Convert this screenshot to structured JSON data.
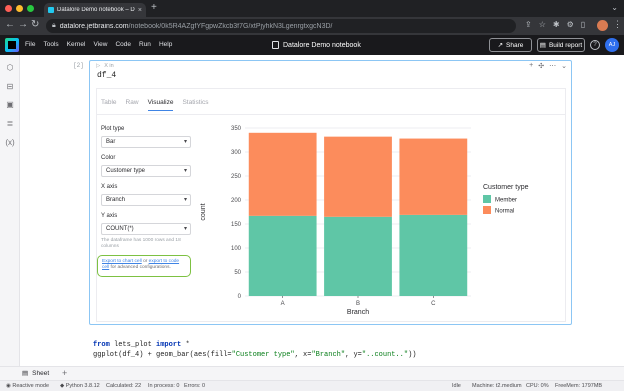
{
  "browser": {
    "tab_title": "Datalore Demo notebook – Dat",
    "url_domain": "datalore.jetbrains.com",
    "url_path": "/notebook/0k5R4AZgfYFgpwZkcb3f7G/xtPjyhkN3LgenrgtxgcN3D/"
  },
  "app": {
    "menu": [
      "File",
      "Tools",
      "Kernel",
      "View",
      "Code",
      "Run",
      "Help"
    ],
    "doc_title": "Datalore Demo notebook",
    "share_label": "Share",
    "build_label": "Build report",
    "help_label": "?",
    "avatar_initials": "AJ"
  },
  "cell1": {
    "number": "[2]",
    "toolbar": "X in",
    "code": "df_4",
    "tabs": [
      "Table",
      "Raw",
      "Visualize",
      "Statistics"
    ],
    "active_tab": "Visualize",
    "controls": {
      "plot_type_label": "Plot type",
      "plot_type_value": "Bar",
      "color_label": "Color",
      "color_value": "Customer type",
      "xaxis_label": "X axis",
      "xaxis_value": "Branch",
      "yaxis_label": "Y axis",
      "yaxis_value": "COUNT(*)"
    },
    "note": "The dataframe has 1000 rows and 18 columns",
    "export_link1": "Export to chart cell",
    "export_or": " or ",
    "export_link2": "export to code cell",
    "export_tail": " for advanced configurations."
  },
  "chart_data": {
    "type": "bar",
    "stacked": true,
    "categories": [
      "A",
      "B",
      "C"
    ],
    "series": [
      {
        "name": "Member",
        "values": [
          167,
          165,
          169
        ],
        "color": "#5fc6a6"
      },
      {
        "name": "Normal",
        "values": [
          173,
          167,
          159
        ],
        "color": "#fc8c5c"
      }
    ],
    "xlabel": "Branch",
    "ylabel": "count",
    "ylim": [
      0,
      350
    ],
    "yticks": [
      0,
      50,
      100,
      150,
      200,
      250,
      300,
      350
    ],
    "legend_title": "Customer type",
    "legend_position": "right",
    "grid": "horizontal"
  },
  "cell2": {
    "line1_kw1": "from",
    "line1_mid": " lets_plot ",
    "line1_kw2": "import",
    "line1_tail": " *",
    "line2_a": "ggplot(df_4) + geom_bar(aes(fill=",
    "line2_s1": "\"Customer type\"",
    "line2_b": ", x=",
    "line2_s2": "\"Branch\"",
    "line2_c": ", y=",
    "line2_s3": "\"..count..\"",
    "line2_d": "))"
  },
  "sheet": {
    "label": "Sheet",
    "add": "+"
  },
  "status": {
    "reactive": "Reactive mode",
    "python": "Python 3.8.12",
    "calculated": "Calculated: 22",
    "in_process": "In process: 0",
    "errors": "Errors: 0",
    "idle": "Idle",
    "machine": "Machine: t2.medium",
    "cpu": "CPU:",
    "cpu_value": "0%",
    "freemem": "FreeMem:",
    "freemem_value": "1797MB"
  }
}
